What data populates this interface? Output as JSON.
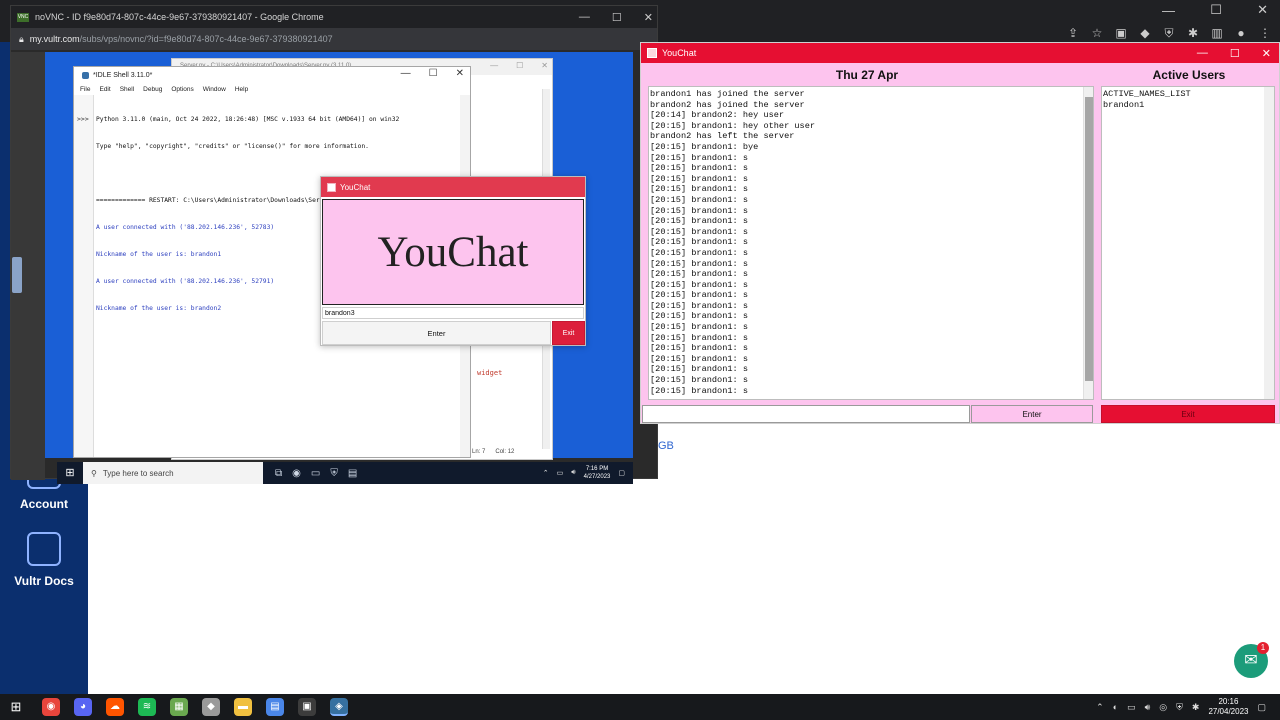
{
  "vnc_window": {
    "title": "noVNC - ID f9e80d74-807c-44ce-9e67-379380921407 - Google Chrome",
    "url_host": "my.vultr.com",
    "url_path": "/subs/vps/novnc/?id=f9e80d74-807c-44ce-9e67-379380921407",
    "min_glyph": "—",
    "max_glyph": "☐",
    "close_glyph": "✕"
  },
  "bg_editor": {
    "title": "Server.py - C:\\Users\\Administrator\\Downloads\\Server.py (3.11.0)",
    "widget_text": "widget",
    "status_ln": "Ln: 7",
    "status_col": "Col: 12"
  },
  "idle": {
    "title": "*IDLE Shell 3.11.0*",
    "menu": [
      "File",
      "Edit",
      "Shell",
      "Debug",
      "Options",
      "Window",
      "Help"
    ],
    "prompt": ">>>",
    "lines": [
      "Python 3.11.0 (main, Oct 24 2022, 18:26:48) [MSC v.1933 64 bit (AMD64)] on win32",
      "Type \"help\", \"copyright\", \"credits\" or \"license()\" for more information.",
      "",
      "============= RESTART: C:\\Users\\Administrator\\Downloads\\Server.py ============="
    ],
    "output_lines": [
      "A user connected with ('88.202.146.236', 52783)",
      "Nickname of the user is: brandon1",
      "A user connected with ('88.202.146.236', 52791)",
      "Nickname of the user is: brandon2"
    ]
  },
  "login_dialog": {
    "title": "YouChat",
    "banner": "YouChat",
    "name_value": "brandon3",
    "enter_label": "Enter",
    "exit_label": "Exit"
  },
  "vnc_taskbar": {
    "search_placeholder": "Type here to search",
    "time": "7:16 PM",
    "date": "4/27/2023"
  },
  "vultr_sidebar": {
    "items": [
      {
        "label": "Account",
        "icon": "account-icon"
      },
      {
        "label": "Vultr Docs",
        "icon": "docs-icon"
      }
    ]
  },
  "host_misc": {
    "gb_text": "GB",
    "chat_badge": "1"
  },
  "youchat": {
    "title": "YouChat",
    "date_header": "Thu 27 Apr",
    "users_header": "Active Users",
    "messages": [
      "brandon1 has joined the server",
      "brandon2 has joined the server",
      "[20:14] brandon2: hey user",
      "[20:15] brandon1: hey other user",
      "brandon2 has left the server",
      "[20:15] brandon1: bye",
      "[20:15] brandon1: s",
      "[20:15] brandon1: s",
      "[20:15] brandon1: s",
      "[20:15] brandon1: s",
      "[20:15] brandon1: s",
      "[20:15] brandon1: s",
      "[20:15] brandon1: s",
      "[20:15] brandon1: s",
      "[20:15] brandon1: s",
      "[20:15] brandon1: s",
      "[20:15] brandon1: s",
      "[20:15] brandon1: s",
      "[20:15] brandon1: s",
      "[20:15] brandon1: s",
      "[20:15] brandon1: s",
      "[20:15] brandon1: s",
      "[20:15] brandon1: s",
      "[20:15] brandon1: s",
      "[20:15] brandon1: s",
      "[20:15] brandon1: s",
      "[20:15] brandon1: s",
      "[20:15] brandon1: s",
      "[20:15] brandon1: s"
    ],
    "active_users": [
      "ACTIVE_NAMES_LIST",
      "brandon1"
    ],
    "message_value": "",
    "enter_label": "Enter",
    "exit_label": "Exit"
  },
  "taskbar": {
    "time": "20:16",
    "date": "27/04/2023",
    "apps": [
      {
        "name": "chrome",
        "icon": "chrome-icon",
        "color": "#e8453c"
      },
      {
        "name": "discord",
        "icon": "discord-icon",
        "color": "#5865f2"
      },
      {
        "name": "soundcloud",
        "icon": "soundcloud-icon",
        "color": "#ff5500"
      },
      {
        "name": "spotify",
        "icon": "spotify-icon",
        "color": "#1db954"
      },
      {
        "name": "minecraft",
        "icon": "minecraft-icon",
        "color": "#6aa84f"
      },
      {
        "name": "roblox",
        "icon": "roblox-icon",
        "color": "#9a9a9a"
      },
      {
        "name": "file-explorer",
        "icon": "folder-icon",
        "color": "#f0c040"
      },
      {
        "name": "notepad",
        "icon": "notepad-icon",
        "color": "#4a86e8"
      },
      {
        "name": "terminal",
        "icon": "terminal-icon",
        "color": "#3c3c3c"
      },
      {
        "name": "python",
        "icon": "python-icon",
        "color": "#3670a0"
      }
    ]
  },
  "colors": {
    "youchat_red": "#e60f32",
    "youchat_pink": "#fdc4ee",
    "vultr_blue": "#0b2f6e",
    "desktop_blue": "#1a5fd6"
  }
}
